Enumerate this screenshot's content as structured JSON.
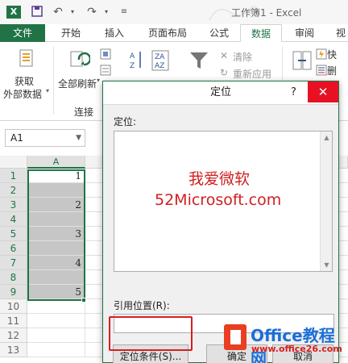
{
  "window": {
    "title": "工作簿1 - Excel",
    "app_logo": "X"
  },
  "tabs": [
    "文件",
    "开始",
    "插入",
    "页面布局",
    "公式",
    "数据",
    "审阅",
    "视"
  ],
  "active_tab": "数据",
  "ribbon": {
    "get_external": "获取\n外部数据",
    "get_external_line1": "获取",
    "get_external_line2": "外部数据",
    "refresh_all": "全部刷新",
    "connections_group": "连接",
    "sort": "排序",
    "filter": "筛选",
    "clear": "清除",
    "reapply": "重新应用",
    "split": "分列",
    "flash": "快",
    "remove": "删"
  },
  "namebox": {
    "value": "A1"
  },
  "grid": {
    "column_header": "A",
    "rows": [
      {
        "num": "1",
        "a": "1"
      },
      {
        "num": "2",
        "a": ""
      },
      {
        "num": "3",
        "a": "2"
      },
      {
        "num": "4",
        "a": ""
      },
      {
        "num": "5",
        "a": "3"
      },
      {
        "num": "6",
        "a": ""
      },
      {
        "num": "7",
        "a": "4"
      },
      {
        "num": "8",
        "a": ""
      },
      {
        "num": "9",
        "a": "5"
      },
      {
        "num": "10",
        "a": ""
      },
      {
        "num": "11",
        "a": ""
      },
      {
        "num": "12",
        "a": ""
      },
      {
        "num": "13",
        "a": ""
      }
    ]
  },
  "dialog": {
    "title": "定位",
    "help": "?",
    "close": "✕",
    "goto_label": "定位:",
    "watermark_line1": "我爱微软",
    "watermark_line2": "52Microsoft.com",
    "reference_label": "引用位置(R):",
    "special_button": "定位条件(S)...",
    "ok_button": "确定",
    "cancel_button": "取消"
  },
  "logo": {
    "name": "Office教程网",
    "url": "www.office26.com"
  },
  "colors": {
    "accent": "#217346",
    "close_red": "#e81123",
    "highlight_red": "#d81e1e"
  }
}
